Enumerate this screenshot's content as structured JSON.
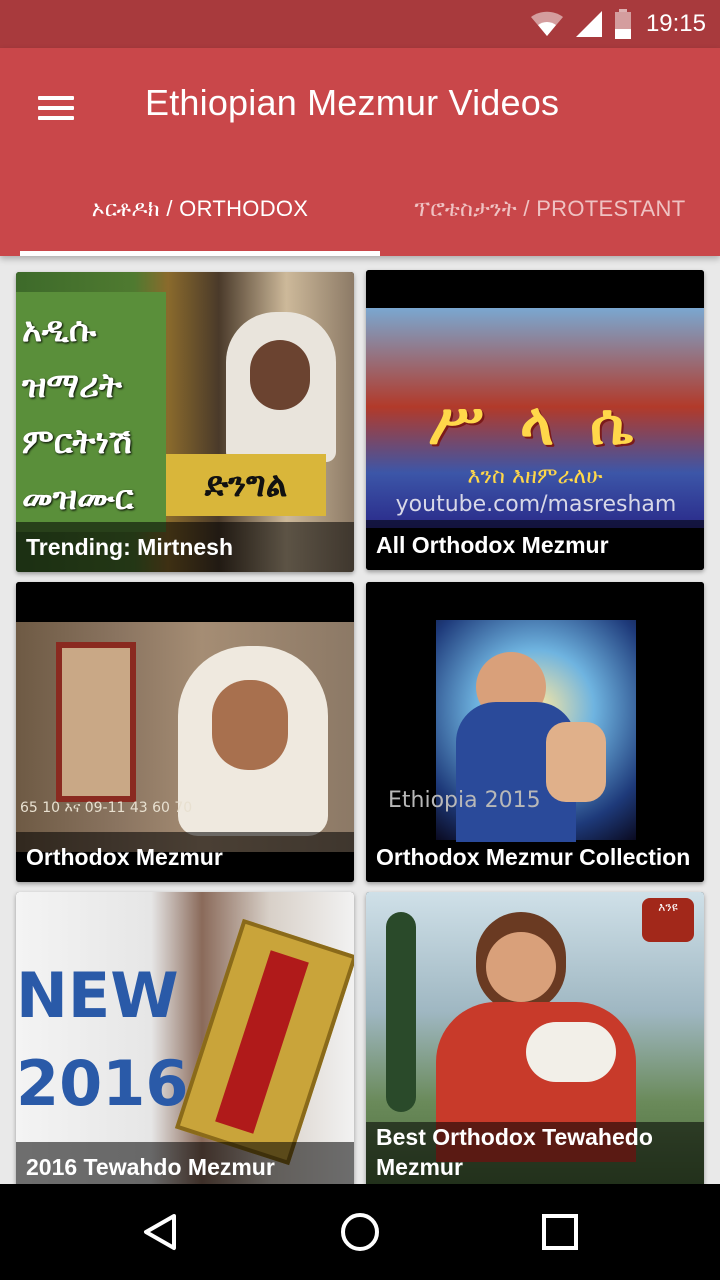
{
  "status": {
    "time": "19:15",
    "icons": [
      "wifi-icon",
      "cell-signal-icon",
      "battery-icon"
    ]
  },
  "app_bar": {
    "title": "Ethiopian Mezmur Videos",
    "menu_icon": "hamburger-menu-icon",
    "color": "#c9474a"
  },
  "tabs": [
    {
      "label": "ኦርቶዶክ / ORTHODOX",
      "selected": true
    },
    {
      "label": "ፕሮቴስታንት / PROTESTANT",
      "selected": false
    }
  ],
  "cards": [
    {
      "caption": "Trending: Mirtnesh",
      "thumb_text": [
        "አዲሱ",
        "ዝማሪት",
        "ምርትነሽ",
        "መዝሙር"
      ],
      "thumb_badge": "ድንግል"
    },
    {
      "caption": "All Orthodox Mezmur",
      "thumb_text": [
        "ሥ ላ ሴ"
      ],
      "thumb_sub": "እንስ እዘምራለሁ",
      "thumb_url": "youtube.com/masresham"
    },
    {
      "caption": "Orthodox Mezmur",
      "thumb_overlay": "65 10 እና 09-11 43 60 70"
    },
    {
      "caption": "Orthodox Mezmur Collection",
      "thumb_overlay": "Ethiopia 2015"
    },
    {
      "caption": "2016 Tewahdo Mezmur",
      "thumb_text": [
        "NEW",
        "2016"
      ]
    },
    {
      "caption": "Best Orthodox Tewahedo Mezmur",
      "thumb_badge": "እንዩ"
    }
  ],
  "nav": {
    "back_icon": "back-triangle-icon",
    "home_icon": "home-circle-icon",
    "recents_icon": "recents-square-icon"
  }
}
